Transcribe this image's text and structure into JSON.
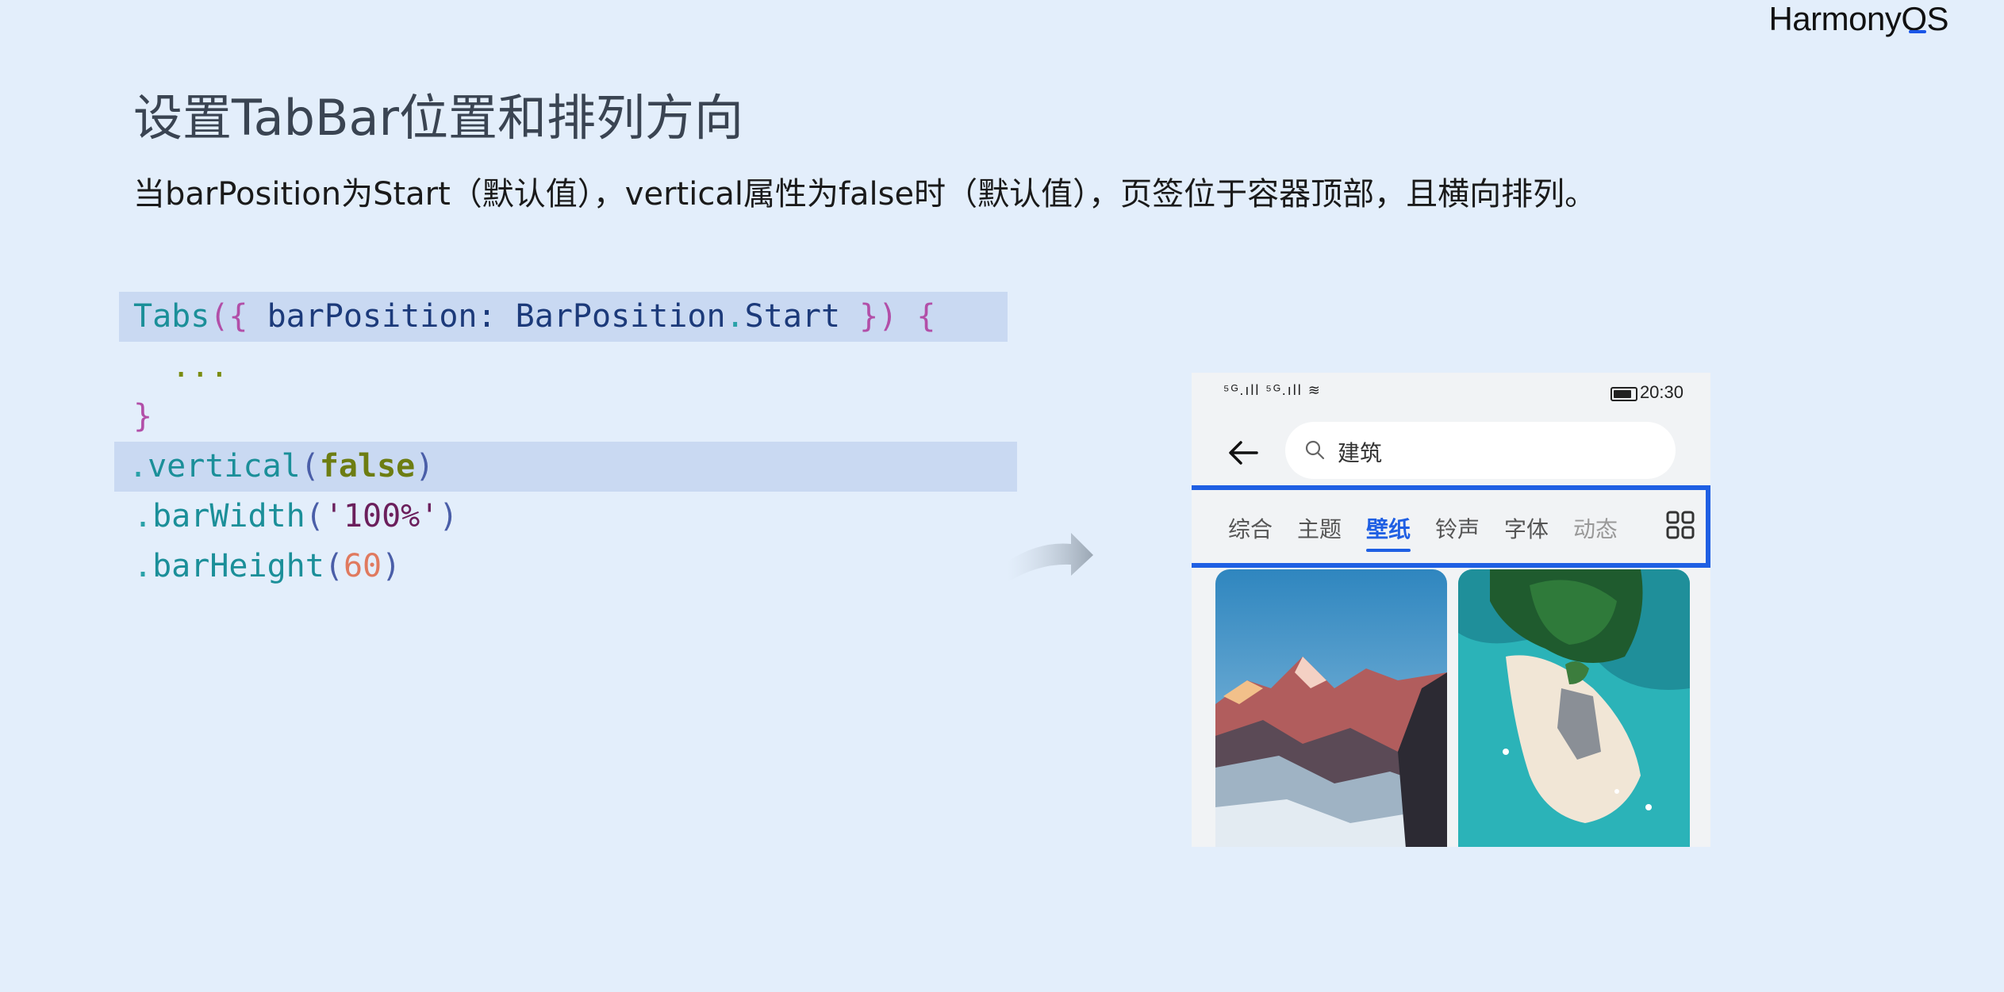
{
  "brand": {
    "logo_text": "HarmonyOS"
  },
  "slide": {
    "title": "设置TabBar位置和排列方向",
    "subtitle": "当barPosition为Start（默认值），vertical属性为false时（默认值），页签位于容器顶部，且横向排列。"
  },
  "code": {
    "l1": {
      "fn": "Tabs",
      "open": "({",
      "key": " barPosition: ",
      "cls": "BarPosition",
      "dot": ".",
      "prop": "Start",
      "close": " })",
      "brace": " {"
    },
    "l2": "  ...",
    "l3": "}",
    "l4": {
      "dot": ".",
      "fn": "vertical",
      "po": "(",
      "arg": "false",
      "pc": ")"
    },
    "l5": {
      "dot": ".",
      "fn": "barWidth",
      "po": "(",
      "arg": "'100%'",
      "pc": ")"
    },
    "l6": {
      "dot": ".",
      "fn": "barHeight",
      "po": "(",
      "arg": "60",
      "pc": ")"
    }
  },
  "phone": {
    "status": {
      "signal": "⁵ᴳ.ıll ⁵ᴳ.ıll ≋",
      "time": "20:30"
    },
    "search_text": "建筑",
    "tabs": [
      {
        "label": "综合"
      },
      {
        "label": "主题"
      },
      {
        "label": "壁纸"
      },
      {
        "label": "铃声"
      },
      {
        "label": "字体"
      },
      {
        "label": "动态"
      }
    ],
    "active_tab": "壁纸"
  },
  "colors": {
    "accent": "#1f5fe3",
    "background": "#e3eefb",
    "highlight": "#c9d9f2"
  }
}
